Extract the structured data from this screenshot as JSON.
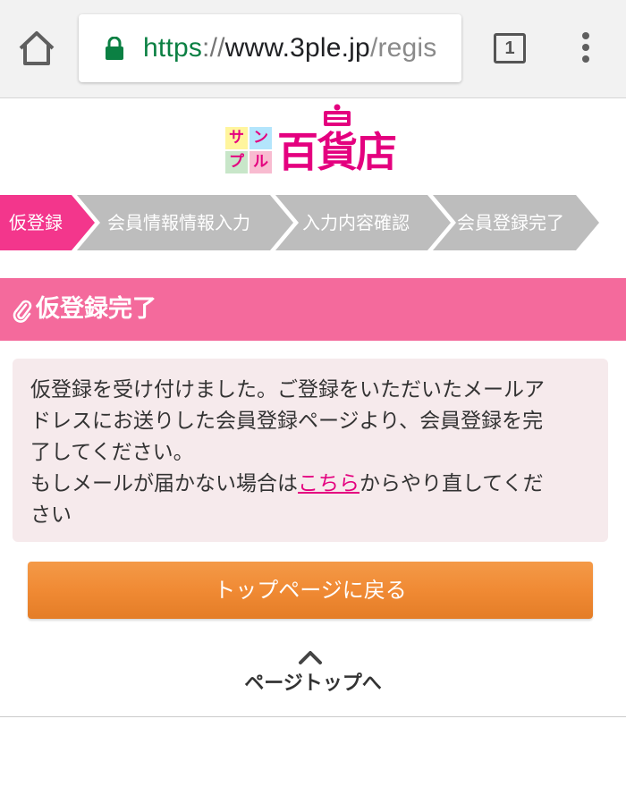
{
  "browser": {
    "url_scheme": "https",
    "url_separator": "://",
    "url_host": "www.3ple.jp",
    "url_path": "/regis",
    "tab_count": "1",
    "secure_color": "#0b8043"
  },
  "logo": {
    "tiles": [
      "サ",
      "ン",
      "プ",
      "ル"
    ],
    "main": "百貨店",
    "brand_color": "#e4007f"
  },
  "steps": {
    "items": [
      {
        "label": "仮登録",
        "active": true
      },
      {
        "label": "会員情報情報入力",
        "active": false
      },
      {
        "label": "入力内容確認",
        "active": false
      },
      {
        "label": "会員登録完了",
        "active": false
      }
    ],
    "active_color": "#f3368c",
    "inactive_color": "#bdbdbd"
  },
  "section": {
    "title": "仮登録完了",
    "icon": "paperclip-icon",
    "color": "#f46a9c"
  },
  "message": {
    "line1": "仮登録を受け付けました。ご登録をいただいたメールア",
    "line2": "ドレスにお送りした会員登録ページより、会員登録を完",
    "line3": "了してください。",
    "line4_pre": "もしメールが届かない場合は",
    "link_text": "こちら",
    "line4_post": "からやり直してくだ",
    "line5": "さい"
  },
  "button": {
    "label": "トップページに戻る",
    "color": "#f08a34"
  },
  "pagetop": {
    "label": "ページトップへ",
    "icon": "chevron-up-icon"
  }
}
